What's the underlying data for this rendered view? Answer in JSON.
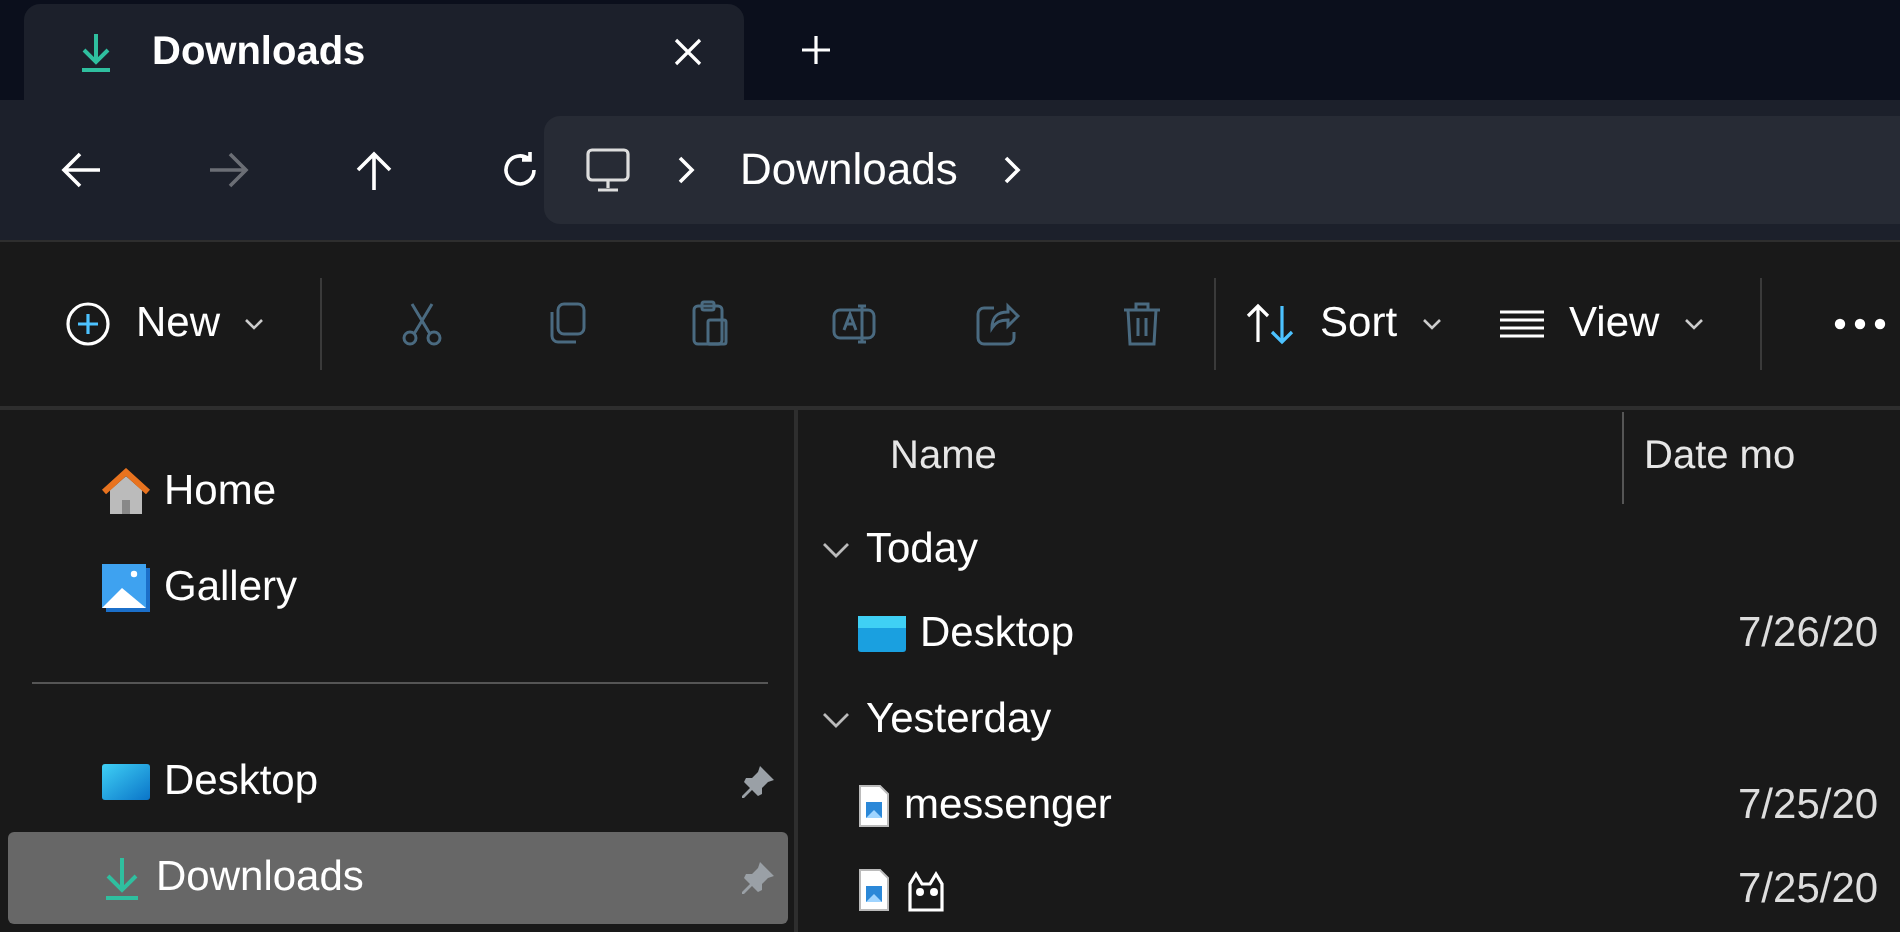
{
  "tabs": [
    {
      "title": "Downloads",
      "selected": true
    }
  ],
  "nav": [
    {
      "kind": "back",
      "disabled": false
    },
    {
      "kind": "forward",
      "disabled": true
    },
    {
      "kind": "up",
      "disabled": false
    },
    {
      "kind": "refresh",
      "disabled": false
    }
  ],
  "address": {
    "segments": [
      "Downloads"
    ]
  },
  "toolbar": [
    {
      "kind": "new",
      "label": "New"
    },
    {
      "kind": "divider"
    },
    {
      "kind": "cut",
      "disabled": true
    },
    {
      "kind": "copy",
      "disabled": true
    },
    {
      "kind": "paste",
      "disabled": true
    },
    {
      "kind": "rename",
      "disabled": true
    },
    {
      "kind": "share",
      "disabled": true
    },
    {
      "kind": "delete",
      "disabled": true
    },
    {
      "kind": "divider"
    },
    {
      "kind": "sort",
      "label": "Sort"
    },
    {
      "kind": "view",
      "label": "View"
    },
    {
      "kind": "divider"
    },
    {
      "kind": "more"
    }
  ],
  "sidebar": {
    "items": [
      {
        "kind": "home",
        "label": "Home",
        "pinned": false,
        "selected": false
      },
      {
        "kind": "gallery",
        "label": "Gallery",
        "pinned": false,
        "selected": false
      },
      {
        "kind": "divider"
      },
      {
        "kind": "desktop",
        "label": "Desktop",
        "pinned": true,
        "selected": false
      },
      {
        "kind": "download",
        "label": "Downloads",
        "pinned": true,
        "selected": true
      }
    ]
  },
  "table": {
    "columns": [
      "Name",
      "Date mo"
    ],
    "groups": [
      {
        "label": "Today",
        "expanded": true,
        "rows": [
          {
            "kind": "desktop",
            "name": "Desktop",
            "date": "7/26/20"
          }
        ]
      },
      {
        "label": "Yesterday",
        "expanded": true,
        "rows": [
          {
            "kind": "image",
            "name": "messenger",
            "date": "7/25/20"
          },
          {
            "kind": "image",
            "date": "7/25/20"
          }
        ]
      }
    ]
  }
}
